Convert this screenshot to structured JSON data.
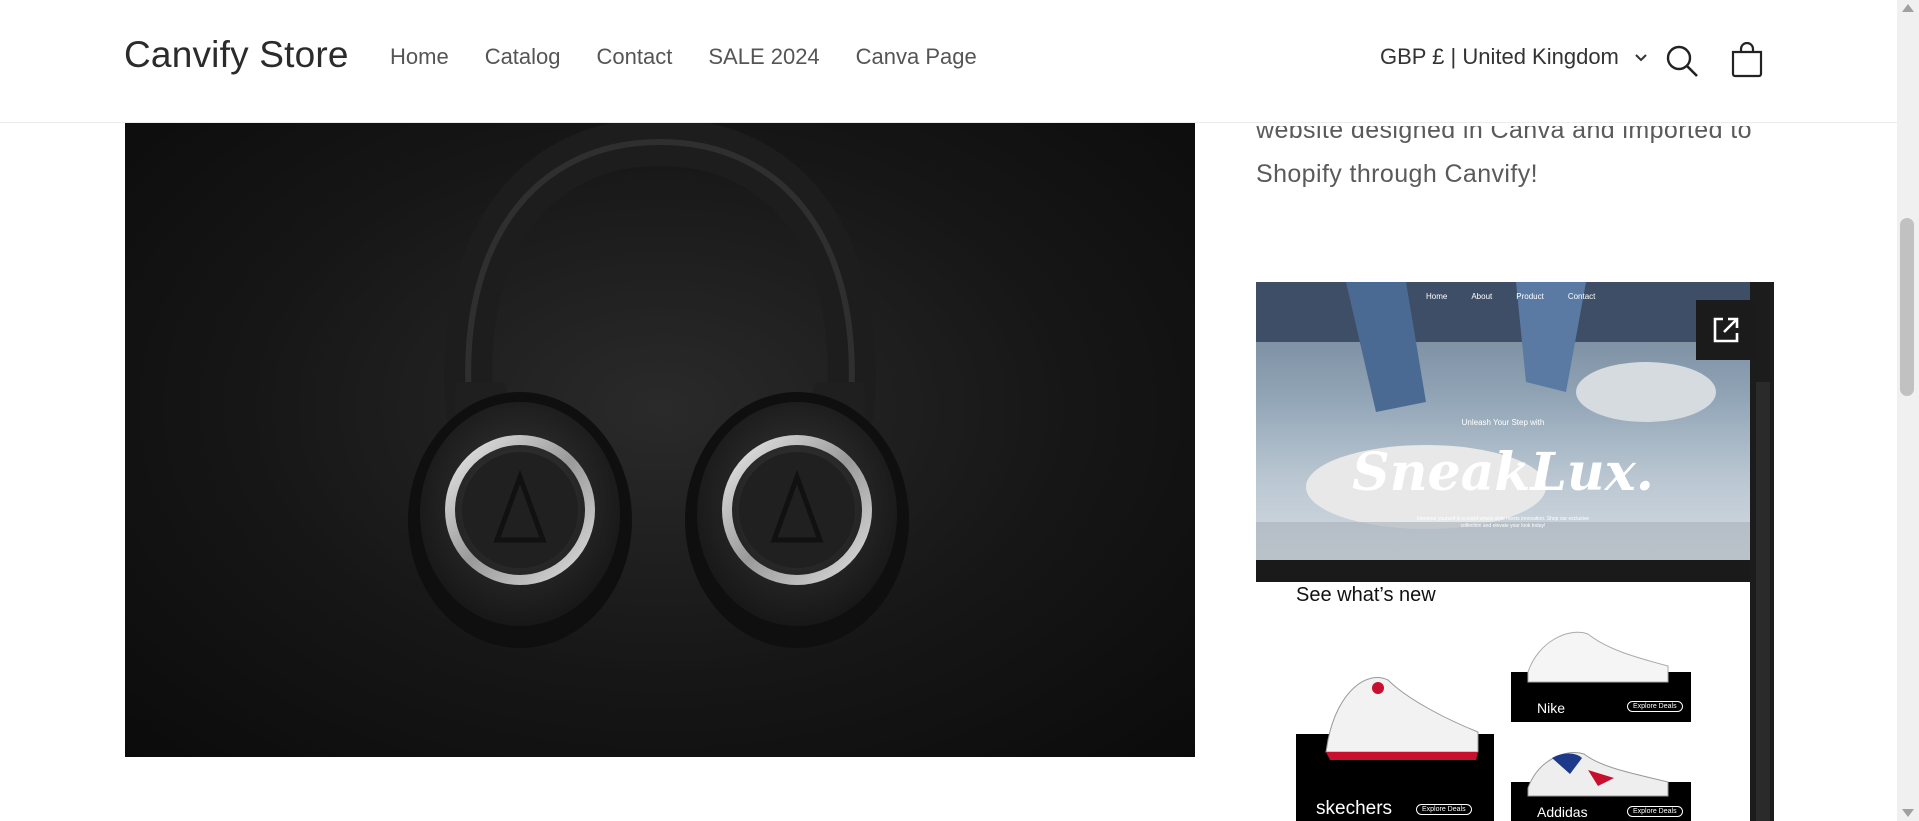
{
  "header": {
    "logo": "Canvify Store",
    "nav": [
      "Home",
      "Catalog",
      "Contact",
      "SALE 2024",
      "Canva Page"
    ],
    "locale": "GBP £ | United Kingdom",
    "icons": {
      "search": "search-icon",
      "cart": "cart-icon",
      "chevron": "chevron-down-icon"
    }
  },
  "hero": {
    "alt": "Black over-ear headphones on dark background"
  },
  "description": {
    "line1": "website designed in Canva and imported to",
    "line2": "Shopify through Canvify!"
  },
  "embed": {
    "nav": [
      "Home",
      "About",
      "Product",
      "Contact"
    ],
    "tagline": "Unleash Your Step with",
    "brand": "SneakLux.",
    "subtext": "Immerse yourself in a world where style meets innovation. Shop our exclusive collection and elevate your look today!",
    "section_title": "See what’s new",
    "cards": [
      {
        "name": "skechers",
        "cta": "Explore Deals"
      },
      {
        "name": "Nike",
        "cta": "Explore Deals"
      },
      {
        "name": "Addidas",
        "cta": "Explore Deals"
      }
    ]
  },
  "colors": {
    "header_bg": "#ffffff",
    "text": "#121212",
    "hero_bg": "#111111",
    "embed_dark": "#1c1c1c"
  }
}
